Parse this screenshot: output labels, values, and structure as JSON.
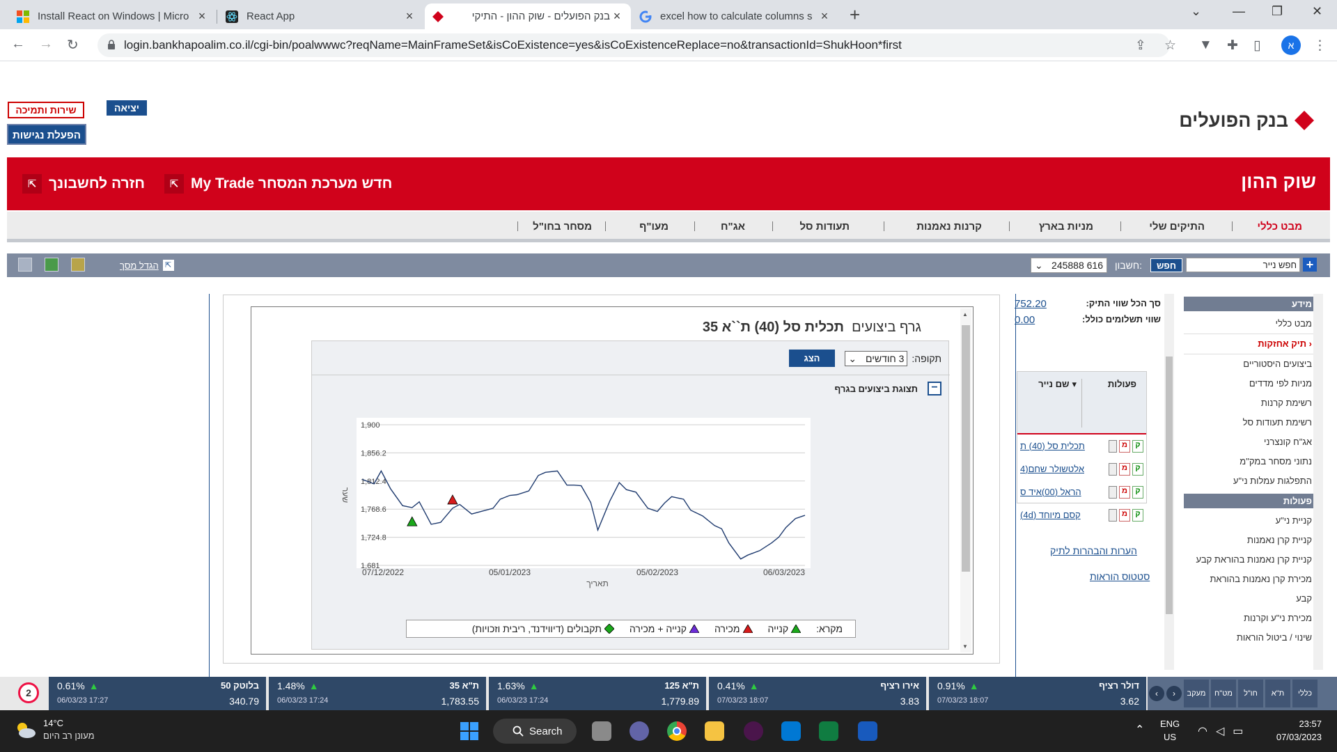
{
  "browser": {
    "tabs": [
      {
        "title": "Install React on Windows | Micro",
        "icon": "windows-logo-icon",
        "active": false
      },
      {
        "title": "React App",
        "icon": "react-logo-icon",
        "active": false
      },
      {
        "title": "בנק הפועלים - שוק ההון - התיקי",
        "icon": "bank-hapoalim-icon",
        "active": true
      },
      {
        "title": "excel how to calculate columns s",
        "icon": "google-icon",
        "active": false
      }
    ],
    "url": "login.bankhapoalim.co.il/cgi-bin/poalwwwc?reqName=MainFrameSet&isCoExistence=yes&isCoExistenceReplace=no&transactionId=ShukHoon*first",
    "profile_initial": "א"
  },
  "header": {
    "service_btn": "שירות ותמיכה",
    "exit_btn": "יציאה",
    "access_btn": "הפעלת נגישות",
    "logo_text": "בנק הפועלים",
    "brand_color": "#d0021b"
  },
  "banner": {
    "title": "שוק ההון",
    "link1": "חדש מערכת המסחר My Trade",
    "link2": "חזרה לחשבונך"
  },
  "nav": [
    "מבט כללי",
    "התיקים שלי",
    "מניות בארץ",
    "קרנות נאמנות",
    "תעודות סל",
    "אג\"ח",
    "מעו\"ף",
    "מסחר בחו\"ל"
  ],
  "toolbar": {
    "search_placeholder": "חפש נייר",
    "find_btn": "חפש",
    "account_label": "חשבון:",
    "account_value": "245888 616",
    "enlarge": "הגדל מסך"
  },
  "sidebar": {
    "section1": "מידע",
    "items1": [
      "מבט כללי",
      "תיק אחזקות",
      "ביצועים היסטוריים",
      "מניות לפי מדדים",
      "רשימת קרנות",
      "רשימת תעודות סל",
      "אג\"ח קונצרני",
      "נתוני מסחר במק\"מ",
      "התפלגות עמלות ני\"ע"
    ],
    "section2": "פעולות",
    "items2": [
      "קניית ני\"ע",
      "קניית קרן נאמנות",
      "קניית קרן נאמנות בהוראת קבע",
      "מכירת קרן נאמנות בהוראת קבע",
      "מכירת ני\"ע וקרנות",
      "שינוי / ביטול הוראות"
    ]
  },
  "summary": {
    "total_label": "סך הכל שווי התיק:",
    "total_value": "752.20",
    "payments_label": "שווי תשלומים כולל:",
    "payments_value": "0.00"
  },
  "portfolio": {
    "col_actions": "פעולות",
    "col_name": "שם נייר",
    "buy": "ק",
    "sell": "מ",
    "rows": [
      "תכלית סל (40) ת",
      "אלטשולר שחם(4",
      "הראל (00)איד ס",
      "קסם מיוחד (4d)"
    ],
    "link_notes": "הערות והבהרות לתיק",
    "link_status": "סטטוס הוראות"
  },
  "panel": {
    "title_prefix": "גרף ביצועים",
    "title_security": "תכלית סל (40) ת``א 35",
    "period_label": "תקופה:",
    "period_value": "3 חודשים",
    "show_btn": "הצג",
    "toggle_label": "תצוגת ביצועים בגרף",
    "legend_title": "מקרא:",
    "legend": [
      "קנייה",
      "מכירה",
      "קנייה + מכירה",
      "תקבולים (דיווידנד, ריבית וזכויות)"
    ]
  },
  "chart_data": {
    "type": "line",
    "xlabel": "תאריך",
    "ylabel": "שער",
    "ylim": [
      1681,
      1900
    ],
    "yticks": [
      "1,900",
      "1,856.2",
      "1,812.4",
      "1,768.6",
      "1,724.8",
      "1,681"
    ],
    "xticks": [
      "07/12/2022",
      "05/01/2023",
      "05/02/2023",
      "06/03/2023"
    ],
    "grid": true,
    "series": [
      {
        "x": [
          0,
          5,
          8,
          12,
          17,
          21,
          24,
          29,
          33,
          38,
          41,
          46,
          51,
          53,
          55,
          58,
          62,
          65,
          70,
          74,
          77,
          82,
          86,
          89,
          92,
          96,
          99,
          104,
          108,
          111,
          115,
          120,
          124,
          127,
          130,
          135,
          138,
          143,
          148,
          151,
          154,
          159,
          162,
          167,
          172,
          175,
          178,
          182,
          186
        ],
        "values": [
          1815,
          1808,
          1828,
          1800,
          1774,
          1771,
          1780,
          1745,
          1748,
          1770,
          1776,
          1761,
          1766,
          1768,
          1770,
          1784,
          1790,
          1791,
          1797,
          1821,
          1826,
          1828,
          1806,
          1806,
          1805,
          1779,
          1736,
          1781,
          1810,
          1799,
          1795,
          1770,
          1765,
          1778,
          1788,
          1784,
          1767,
          1758,
          1743,
          1738,
          1716,
          1691,
          1697,
          1704,
          1716,
          1725,
          1740,
          1754,
          1759
        ]
      }
    ],
    "markers": [
      {
        "kind": "buy",
        "x": 21,
        "y": 1749
      },
      {
        "kind": "sell",
        "x": 38,
        "y": 1783
      }
    ]
  },
  "statusbar": [
    {
      "name": "דולר רציף",
      "pct": "0.91%",
      "date": "07/03/23 18:07",
      "value": "3.62"
    },
    {
      "name": "אירו רציף",
      "pct": "0.41%",
      "date": "07/03/23 18:07",
      "value": "3.83"
    },
    {
      "name": "ת\"א 125",
      "pct": "1.63%",
      "date": "06/03/23 17:24",
      "value": "1,779.89"
    },
    {
      "name": "ת\"א 35",
      "pct": "1.48%",
      "date": "06/03/23 17:24",
      "value": "1,783.55"
    },
    {
      "name": "בלוטק 50",
      "pct": "0.61%",
      "date": "06/03/23 17:27",
      "value": "340.79"
    }
  ],
  "statusbar_tabs": [
    "כללי",
    "ת\"א",
    "חו\"ל",
    "מט\"ח",
    "מעקב"
  ],
  "statusbar_badge": "2",
  "taskbar": {
    "temp": "14°C",
    "weather": "מעונן רב היום",
    "search": "Search",
    "lang1": "ENG",
    "lang2": "US",
    "time": "23:57",
    "date": "07/03/2023"
  }
}
